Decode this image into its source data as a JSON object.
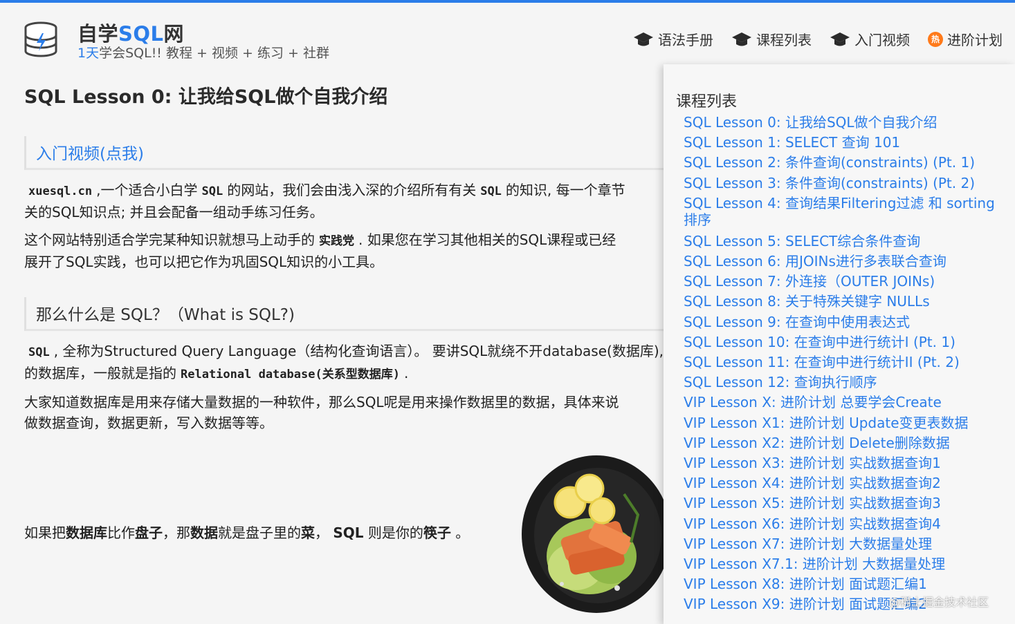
{
  "site": {
    "title_main": "自学",
    "title_accent": "SQL",
    "title_end": "网",
    "subtitle_accent": "1天",
    "subtitle_rest": "学会SQL!! 教程 + 视频 + 练习 + 社群"
  },
  "nav": {
    "items": [
      "语法手册",
      "课程列表",
      "入门视频",
      "进阶计划"
    ],
    "hot_badge": "热"
  },
  "page": {
    "title": "SQL Lesson 0: 让我给SQL做个自我介绍",
    "video_link": "入门视频(点我)",
    "p1a_term": "xuesql.cn",
    "p1a_mid": ",一个适合小白学",
    "p1a_sql": "SQL",
    "p1a_rest": "的网站，我们会由浅入深的介绍所有有关",
    "p1a_sql2": "SQL",
    "p1a_end": "的知识, 每一个章节",
    "p1b": "关的SQL知识点; 并且会配备一组动手练习任务。",
    "p2a_start": "这个网站特别适合学完某种知识就想马上动手的",
    "p2a_bold": "实践党",
    "p2a_rest": ". 如果您在学习其他相关的SQL课程或已经",
    "p2b": "展开了SQL实践，也可以把它作为巩固SQL知识的小工具。",
    "section2": "那么什么是 SQL？（What is SQL?)",
    "p3a_term": "SQL",
    "p3a_rest": ", 全称为Structured Query Language（结构化查询语言）。 要讲SQL就绕不开database(数据库),",
    "p3b_start": "的数据库，一般就是指的",
    "p3b_bold": "Relational database(关系型数据库)",
    "p3b_end": ".",
    "p4a": "大家知道数据库是用来存储大量数据的一种软件，那么SQL呢是用来操作数据里的数据，具体来说",
    "p4b": "做数据查询，数据更新，写入数据等等。",
    "analogy": {
      "t1": "如果把",
      "b1": "数据库",
      "t2": "比作",
      "b2": "盘子",
      "t3": "，那",
      "b3": "数据",
      "t4": "就是盘子里的",
      "b4": "菜",
      "t5": "，",
      "b5": "SQL",
      "t6": "则是你的",
      "b6": "筷子",
      "t7": "。"
    }
  },
  "panel": {
    "title": "课程列表",
    "lessons": [
      "SQL Lesson 0: 让我给SQL做个自我介绍",
      "SQL Lesson 1: SELECT 查询 101",
      "SQL Lesson 2: 条件查询(constraints) (Pt. 1)",
      "SQL Lesson 3: 条件查询(constraints) (Pt. 2)",
      "SQL Lesson 4: 查询结果Filtering过滤 和 sorting排序",
      "SQL Lesson 5: SELECT综合条件查询",
      "SQL Lesson 6: 用JOINs进行多表联合查询",
      "SQL Lesson 7: 外连接（OUTER JOINs)",
      "SQL Lesson 8: 关于特殊关键字 NULLs",
      "SQL Lesson 9: 在查询中使用表达式",
      "SQL Lesson 10: 在查询中进行统计I (Pt. 1)",
      "SQL Lesson 11: 在查询中进行统计II (Pt. 2)",
      "SQL Lesson 12: 查询执行顺序",
      "VIP Lesson X: 进阶计划 总要学会Create",
      "VIP Lesson X1: 进阶计划 Update变更表数据",
      "VIP Lesson X2: 进阶计划 Delete删除数据",
      "VIP Lesson X3: 进阶计划 实战数据查询1",
      "VIP Lesson X4: 进阶计划 实战数据查询2",
      "VIP Lesson X5: 进阶计划 实战数据查询3",
      "VIP Lesson X6: 进阶计划 实战数据查询4",
      "VIP Lesson X7: 进阶计划 大数据量处理",
      "VIP Lesson X7.1: 进阶计划 大数据量处理",
      "VIP Lesson X8: 进阶计划 面试题汇编1",
      "VIP Lesson X9: 进阶计划 面试题汇编2"
    ]
  },
  "watermark": "@稀土掘金技术社区",
  "colors": {
    "accent": "#2b7de9",
    "hot": "#ff7a1a"
  }
}
